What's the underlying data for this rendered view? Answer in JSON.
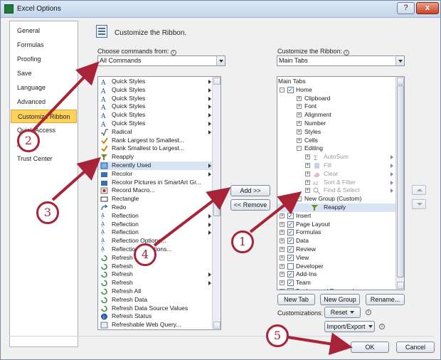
{
  "window": {
    "title": "Excel Options",
    "help_glyph": "?",
    "close_glyph": "x"
  },
  "nav": {
    "items": [
      {
        "label": "General"
      },
      {
        "label": "Formulas"
      },
      {
        "label": "Proofing"
      },
      {
        "label": "Save"
      },
      {
        "label": "Language"
      },
      {
        "label": "Advanced"
      },
      {
        "label": "Customize Ribbon",
        "selected": true
      },
      {
        "label": "Quick Access Toolbar"
      },
      {
        "label": "Add-Ins"
      },
      {
        "label": "Trust Center"
      }
    ]
  },
  "header": {
    "title": "Customize the Ribbon."
  },
  "left": {
    "label": "Choose commands from:",
    "combo_value": "All Commands",
    "commands": [
      {
        "label": "Quick Styles",
        "submenu": true,
        "icon": "quick-styles-icon"
      },
      {
        "label": "Quick Styles",
        "submenu": true,
        "icon": "quick-styles-icon"
      },
      {
        "label": "Quick Styles",
        "submenu": true,
        "icon": "quick-styles-icon"
      },
      {
        "label": "Quick Styles",
        "submenu": true,
        "icon": "quick-styles-icon"
      },
      {
        "label": "Quick Styles",
        "submenu": true,
        "icon": "quick-styles-icon"
      },
      {
        "label": "Quick Styles",
        "submenu": true,
        "icon": "quick-styles-icon"
      },
      {
        "label": "Radical",
        "submenu": true,
        "icon": "radical-icon"
      },
      {
        "label": "Rank Largest to Smallest...",
        "submenu": false,
        "icon": "rank-icon"
      },
      {
        "label": "Rank Smallest to Largest...",
        "submenu": false,
        "icon": "rank-icon"
      },
      {
        "label": "Reapply",
        "submenu": false,
        "icon": "reapply-icon"
      },
      {
        "label": "Recently Used",
        "submenu": true,
        "icon": "recently-used-icon",
        "selected": true
      },
      {
        "label": "Recolor",
        "submenu": true,
        "icon": "recolor-icon"
      },
      {
        "label": "Recolor Pictures in SmartArt Gr...",
        "submenu": false,
        "icon": "recolor-icon"
      },
      {
        "label": "Record Macro...",
        "submenu": false,
        "icon": "record-macro-icon"
      },
      {
        "label": "Rectangle",
        "submenu": false,
        "icon": "rectangle-icon"
      },
      {
        "label": "Redo",
        "submenu": false,
        "icon": "redo-icon"
      },
      {
        "label": "Reflection",
        "submenu": true,
        "icon": "reflection-icon"
      },
      {
        "label": "Reflection",
        "submenu": true,
        "icon": "reflection-icon"
      },
      {
        "label": "Reflection",
        "submenu": true,
        "icon": "reflection-icon"
      },
      {
        "label": "Reflection Options...",
        "submenu": false,
        "icon": "reflection-icon"
      },
      {
        "label": "Reflection Variations...",
        "submenu": false,
        "icon": "reflection-icon"
      },
      {
        "label": "Refresh",
        "submenu": false,
        "icon": "refresh-icon"
      },
      {
        "label": "Refresh",
        "submenu": false,
        "icon": "refresh-icon"
      },
      {
        "label": "Refresh",
        "submenu": true,
        "icon": "refresh-icon"
      },
      {
        "label": "Refresh",
        "submenu": true,
        "icon": "refresh-icon"
      },
      {
        "label": "Refresh All",
        "submenu": false,
        "icon": "refresh-icon"
      },
      {
        "label": "Refresh Data",
        "submenu": false,
        "icon": "refresh-icon"
      },
      {
        "label": "Refresh Data Source Values",
        "submenu": false,
        "icon": "refresh-icon"
      },
      {
        "label": "Refresh Status",
        "submenu": false,
        "icon": "info-icon"
      },
      {
        "label": "Refreshable Web Query...",
        "submenu": false,
        "icon": "web-query-icon"
      }
    ]
  },
  "middle": {
    "add_label": "Add >>",
    "remove_label": "<< Remove"
  },
  "right": {
    "label": "Customize the Ribbon:",
    "combo_value": "Main Tabs",
    "tree": [
      {
        "label": "Main Tabs",
        "level": 0,
        "header": true
      },
      {
        "label": "Home",
        "level": 0,
        "expander": "-",
        "checked": true
      },
      {
        "label": "Clipboard",
        "level": 1,
        "expander": "+"
      },
      {
        "label": "Font",
        "level": 1,
        "expander": "+"
      },
      {
        "label": "Alignment",
        "level": 1,
        "expander": "+"
      },
      {
        "label": "Number",
        "level": 1,
        "expander": "+"
      },
      {
        "label": "Styles",
        "level": 1,
        "expander": "+"
      },
      {
        "label": "Cells",
        "level": 1,
        "expander": "+"
      },
      {
        "label": "Editing",
        "level": 1,
        "expander": "-"
      },
      {
        "label": "AutoSum",
        "level": 2,
        "expander": "+",
        "dim": true,
        "submenu": true,
        "icon": "autosum-icon"
      },
      {
        "label": "Fill",
        "level": 2,
        "expander": "+",
        "dim": true,
        "submenu": true,
        "icon": "fill-icon"
      },
      {
        "label": "Clear",
        "level": 2,
        "expander": "+",
        "dim": true,
        "submenu": true,
        "icon": "clear-icon"
      },
      {
        "label": "Sort & Filter",
        "level": 2,
        "expander": "+",
        "dim": true,
        "submenu": true,
        "icon": "sort-filter-icon"
      },
      {
        "label": "Find & Select",
        "level": 2,
        "expander": "+",
        "dim": true,
        "submenu": true,
        "icon": "find-select-icon"
      },
      {
        "label": "New Group (Custom)",
        "level": 1,
        "expander": "-"
      },
      {
        "label": "Reapply",
        "level": 2,
        "icon": "reapply-icon",
        "selected": true
      },
      {
        "label": "Insert",
        "level": 0,
        "expander": "+",
        "checked": true
      },
      {
        "label": "Page Layout",
        "level": 0,
        "expander": "+",
        "checked": true
      },
      {
        "label": "Formulas",
        "level": 0,
        "expander": "+",
        "checked": true
      },
      {
        "label": "Data",
        "level": 0,
        "expander": "+",
        "checked": true
      },
      {
        "label": "Review",
        "level": 0,
        "expander": "+",
        "checked": true
      },
      {
        "label": "View",
        "level": 0,
        "expander": "+",
        "checked": true
      },
      {
        "label": "Developer",
        "level": 0,
        "expander": "+",
        "checked": false
      },
      {
        "label": "Add-Ins",
        "level": 0,
        "expander": "+",
        "checked": true
      },
      {
        "label": "Team",
        "level": 0,
        "expander": "+",
        "checked": true
      },
      {
        "label": "Background Removal",
        "level": 0,
        "expander": "+",
        "checked": true
      }
    ],
    "new_tab_label": "New Tab",
    "new_group_label": "New Group",
    "rename_label": "Rename...",
    "customizations_label": "Customizations:",
    "reset_label": "Reset",
    "import_export_label": "Import/Export"
  },
  "footer": {
    "ok_label": "OK",
    "cancel_label": "Cancel"
  },
  "annotations": {
    "color": "#a82238",
    "callouts": [
      "1",
      "2",
      "3",
      "4",
      "5"
    ]
  }
}
